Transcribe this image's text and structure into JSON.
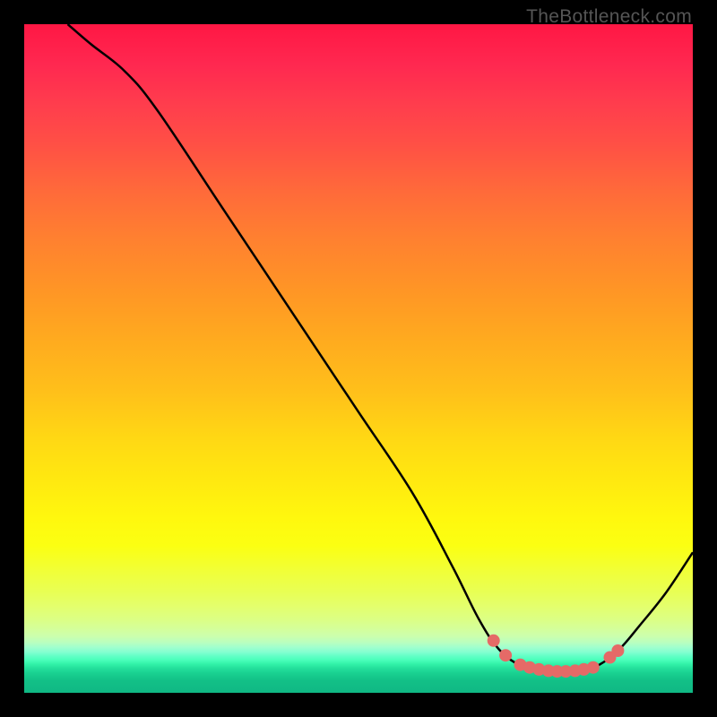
{
  "watermark": "TheBottleneck.com",
  "chart_data": {
    "type": "line",
    "title": "",
    "xlabel": "",
    "ylabel": "",
    "xlim": [
      0,
      100
    ],
    "ylim": [
      0,
      100
    ],
    "curve": [
      {
        "x": 6.5,
        "y": 100
      },
      {
        "x": 10,
        "y": 97
      },
      {
        "x": 15,
        "y": 93
      },
      {
        "x": 20,
        "y": 87
      },
      {
        "x": 30,
        "y": 72
      },
      {
        "x": 40,
        "y": 57
      },
      {
        "x": 50,
        "y": 42
      },
      {
        "x": 58,
        "y": 30
      },
      {
        "x": 64,
        "y": 19
      },
      {
        "x": 68,
        "y": 11
      },
      {
        "x": 71,
        "y": 6.5
      },
      {
        "x": 74,
        "y": 4.2
      },
      {
        "x": 77,
        "y": 3.4
      },
      {
        "x": 80,
        "y": 3.2
      },
      {
        "x": 83,
        "y": 3.4
      },
      {
        "x": 86,
        "y": 4.2
      },
      {
        "x": 89,
        "y": 6.5
      },
      {
        "x": 92,
        "y": 10
      },
      {
        "x": 96,
        "y": 15
      },
      {
        "x": 100,
        "y": 21
      }
    ],
    "points": [
      {
        "x": 70.2,
        "y": 7.8
      },
      {
        "x": 72.0,
        "y": 5.6
      },
      {
        "x": 74.2,
        "y": 4.2
      },
      {
        "x": 75.6,
        "y": 3.8
      },
      {
        "x": 77.0,
        "y": 3.5
      },
      {
        "x": 78.4,
        "y": 3.3
      },
      {
        "x": 79.7,
        "y": 3.2
      },
      {
        "x": 81.0,
        "y": 3.2
      },
      {
        "x": 82.4,
        "y": 3.3
      },
      {
        "x": 83.7,
        "y": 3.5
      },
      {
        "x": 85.1,
        "y": 3.8
      },
      {
        "x": 87.6,
        "y": 5.3
      },
      {
        "x": 88.8,
        "y": 6.3
      }
    ]
  }
}
